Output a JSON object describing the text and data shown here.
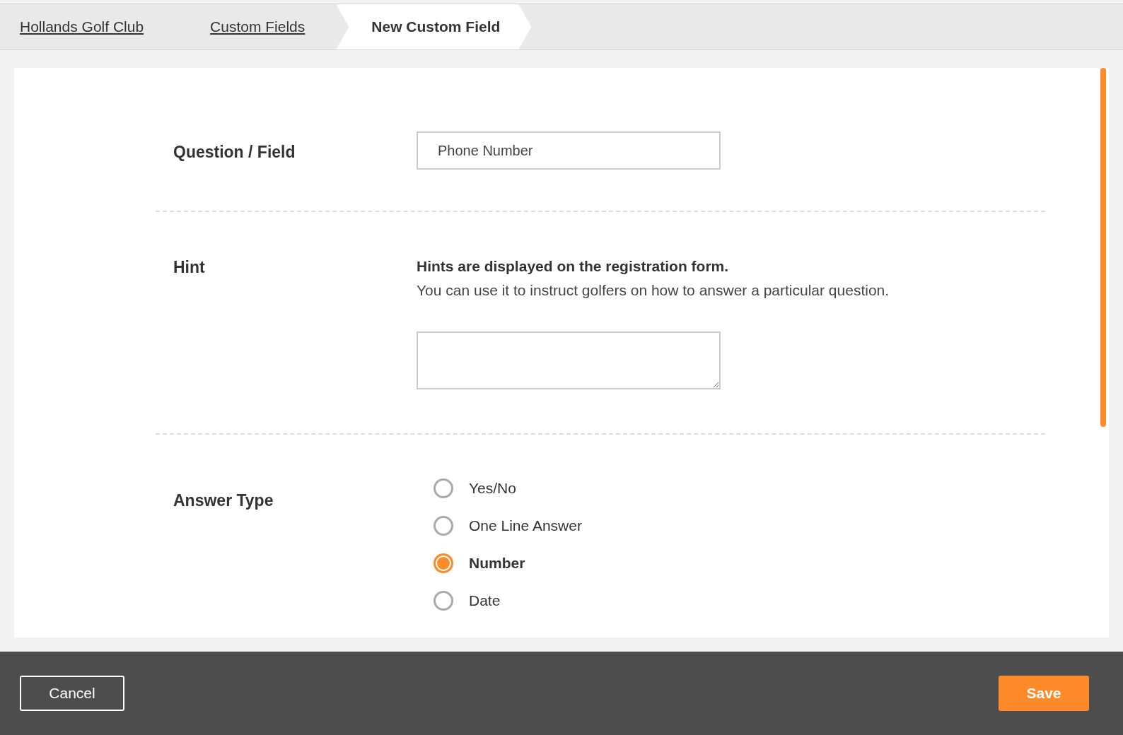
{
  "breadcrumbs": [
    {
      "label": "Hollands Golf Club",
      "selected": false
    },
    {
      "label": "Custom Fields",
      "selected": false
    },
    {
      "label": "New Custom Field",
      "selected": true
    }
  ],
  "question": {
    "label": "Question / Field",
    "value": "Phone Number"
  },
  "hint": {
    "label": "Hint",
    "title": "Hints are displayed on the registration form.",
    "description": "You can use it to instruct golfers on how to answer a particular question."
  },
  "answer_type": {
    "label": "Answer Type",
    "options": [
      {
        "label": "Yes/No",
        "selected": false
      },
      {
        "label": "One Line Answer",
        "selected": false
      },
      {
        "label": "Number",
        "selected": true
      },
      {
        "label": "Date",
        "selected": false
      }
    ]
  },
  "footer": {
    "cancel": "Cancel",
    "save": "Save"
  }
}
